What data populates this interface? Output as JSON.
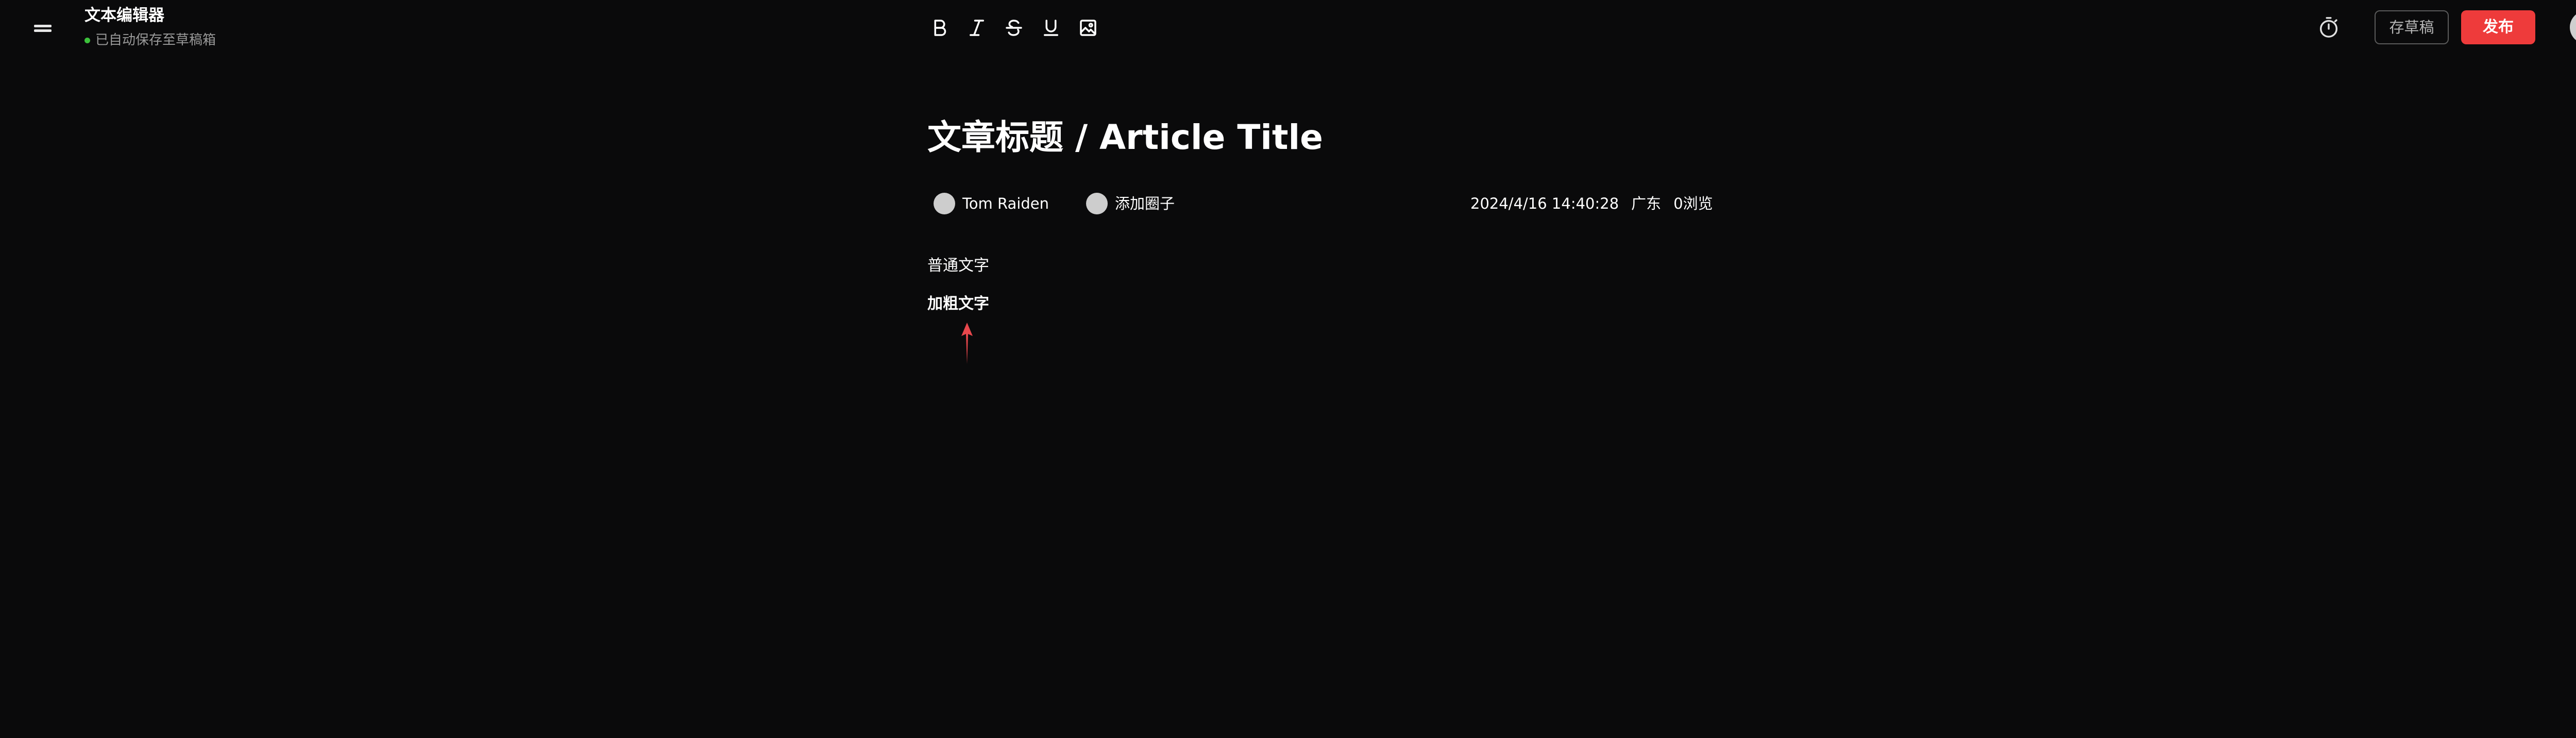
{
  "header": {
    "menu_icon": "hamburger-icon",
    "app_title": "文本编辑器",
    "autosave_text": "已自动保存至草稿箱",
    "autosave_color": "#3cc13b"
  },
  "toolbar": {
    "tools": [
      "bold-icon",
      "italic-icon",
      "strikethrough-icon",
      "underline-icon",
      "image-icon"
    ]
  },
  "actions": {
    "timer_icon": "timer-icon",
    "draft_label": "存草稿",
    "publish_label": "发布",
    "publish_color": "#ee3b3b"
  },
  "article": {
    "title": "文章标题 / Article Title",
    "author": "Tom Raiden",
    "circle_label": "添加圈子",
    "datetime": "2024/4/16 14:40:28",
    "location": "广东",
    "views": "0浏览",
    "paragraphs": {
      "normal": "普通文字",
      "bold": "加粗文字"
    }
  },
  "annotation": {
    "arrow_color": "#e8474c"
  }
}
